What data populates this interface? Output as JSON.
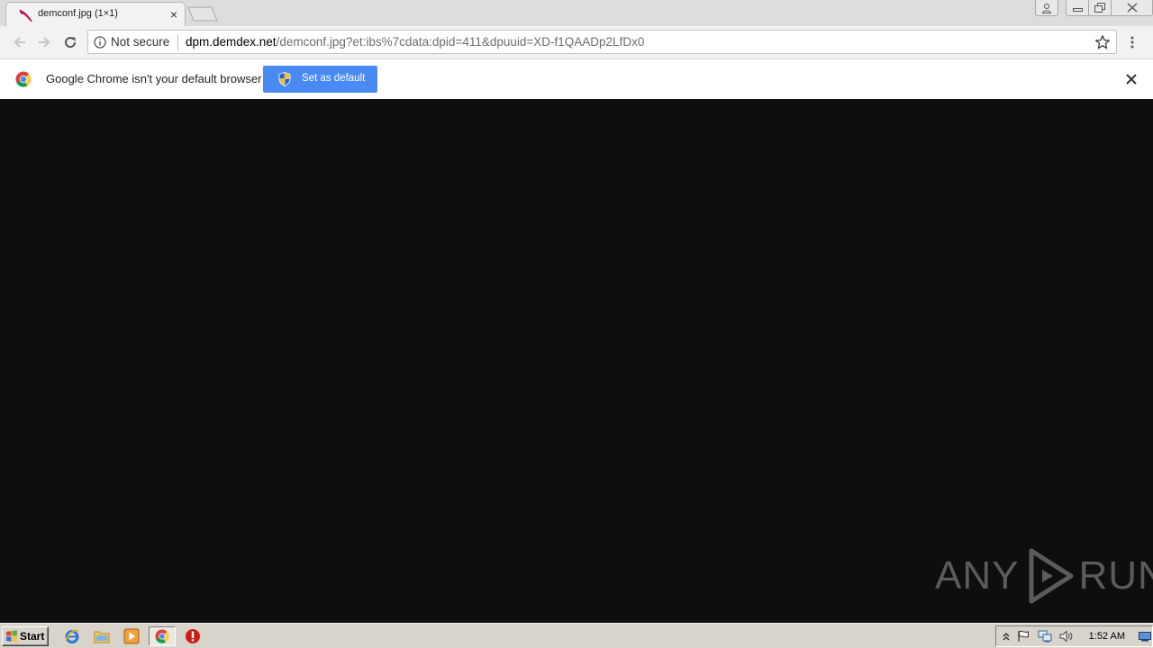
{
  "browser": {
    "tab": {
      "title": "demconf.jpg (1×1)",
      "favicon": "image-feather-icon",
      "close": "×"
    },
    "window_buttons": [
      "user-icon",
      "minimize-icon",
      "maximize-icon",
      "close-icon"
    ]
  },
  "toolbar": {
    "security_label": "Not secure",
    "url_host": "dpm.demdex.net",
    "url_path": "/demconf.jpg?et:ibs%7cdata:dpid=411&dpuuid=XD-f1QAADp2LfDx0"
  },
  "infobar": {
    "message": "Google Chrome isn't your default browser",
    "button_label": "Set as default"
  },
  "watermark": {
    "left": "ANY",
    "right": "RUN"
  },
  "taskbar": {
    "start_label": "Start",
    "pinned": [
      "internet-explorer-icon",
      "explorer-folder-icon",
      "media-player-icon",
      "chrome-icon",
      "stop-icon"
    ],
    "tray_icons": [
      "show-hidden-icon",
      "flag-icon",
      "network-icon",
      "volume-icon"
    ],
    "clock": "1:52 AM"
  }
}
